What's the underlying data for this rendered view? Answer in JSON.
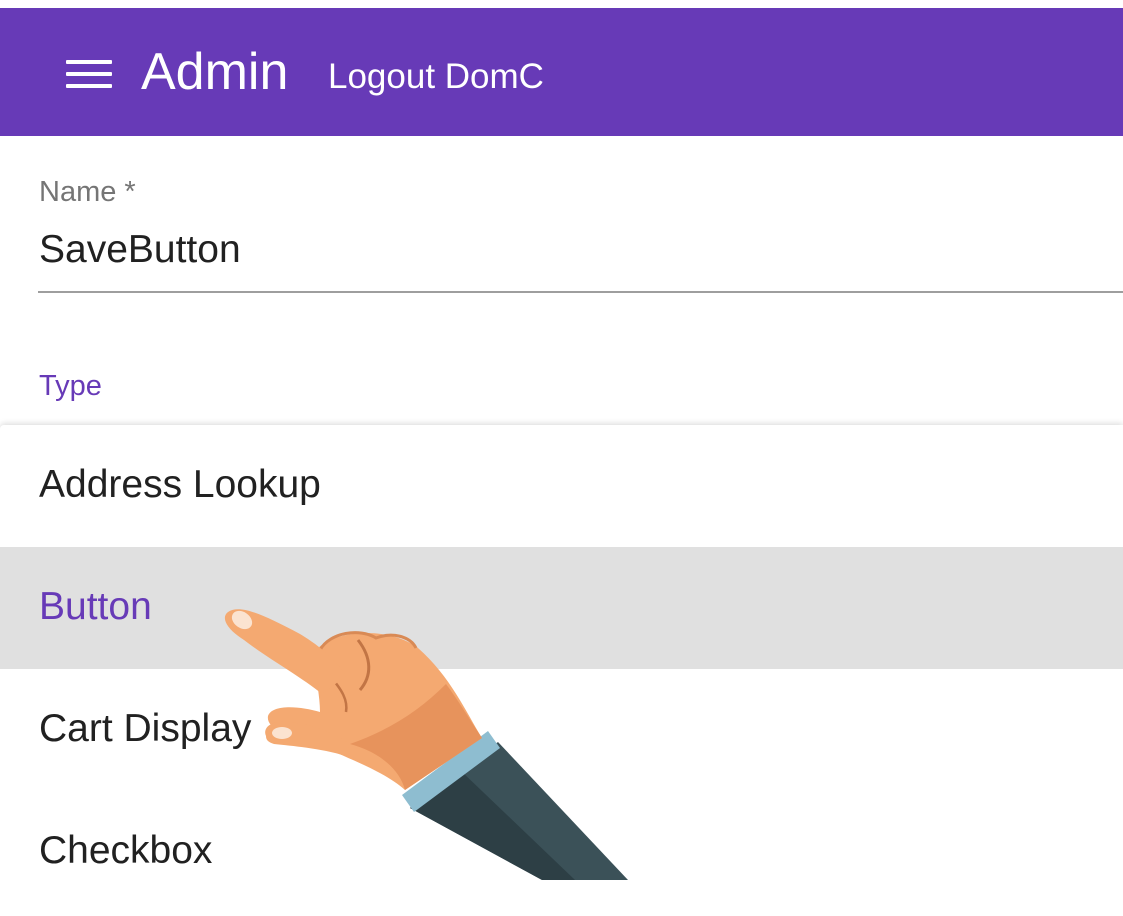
{
  "app_bar": {
    "title": "Admin",
    "logout_label": "Logout DomC",
    "background_color": "#673ab7",
    "menu_icon": "hamburger-menu-icon"
  },
  "form": {
    "name_field": {
      "label": "Name *",
      "value": "SaveButton"
    },
    "type_field": {
      "label": "Type",
      "options": [
        {
          "label": "Address Lookup",
          "selected": false
        },
        {
          "label": "Button",
          "selected": true
        },
        {
          "label": "Cart Display",
          "selected": false
        },
        {
          "label": "Checkbox",
          "selected": false
        }
      ]
    }
  },
  "colors": {
    "accent": "#673ab7",
    "selected_row": "#e0e0e0",
    "skin": "#f4a971",
    "sleeve": "#3b5158",
    "cuff": "#8ebdd0"
  },
  "overlay": {
    "icon": "pointing-hand-icon"
  }
}
